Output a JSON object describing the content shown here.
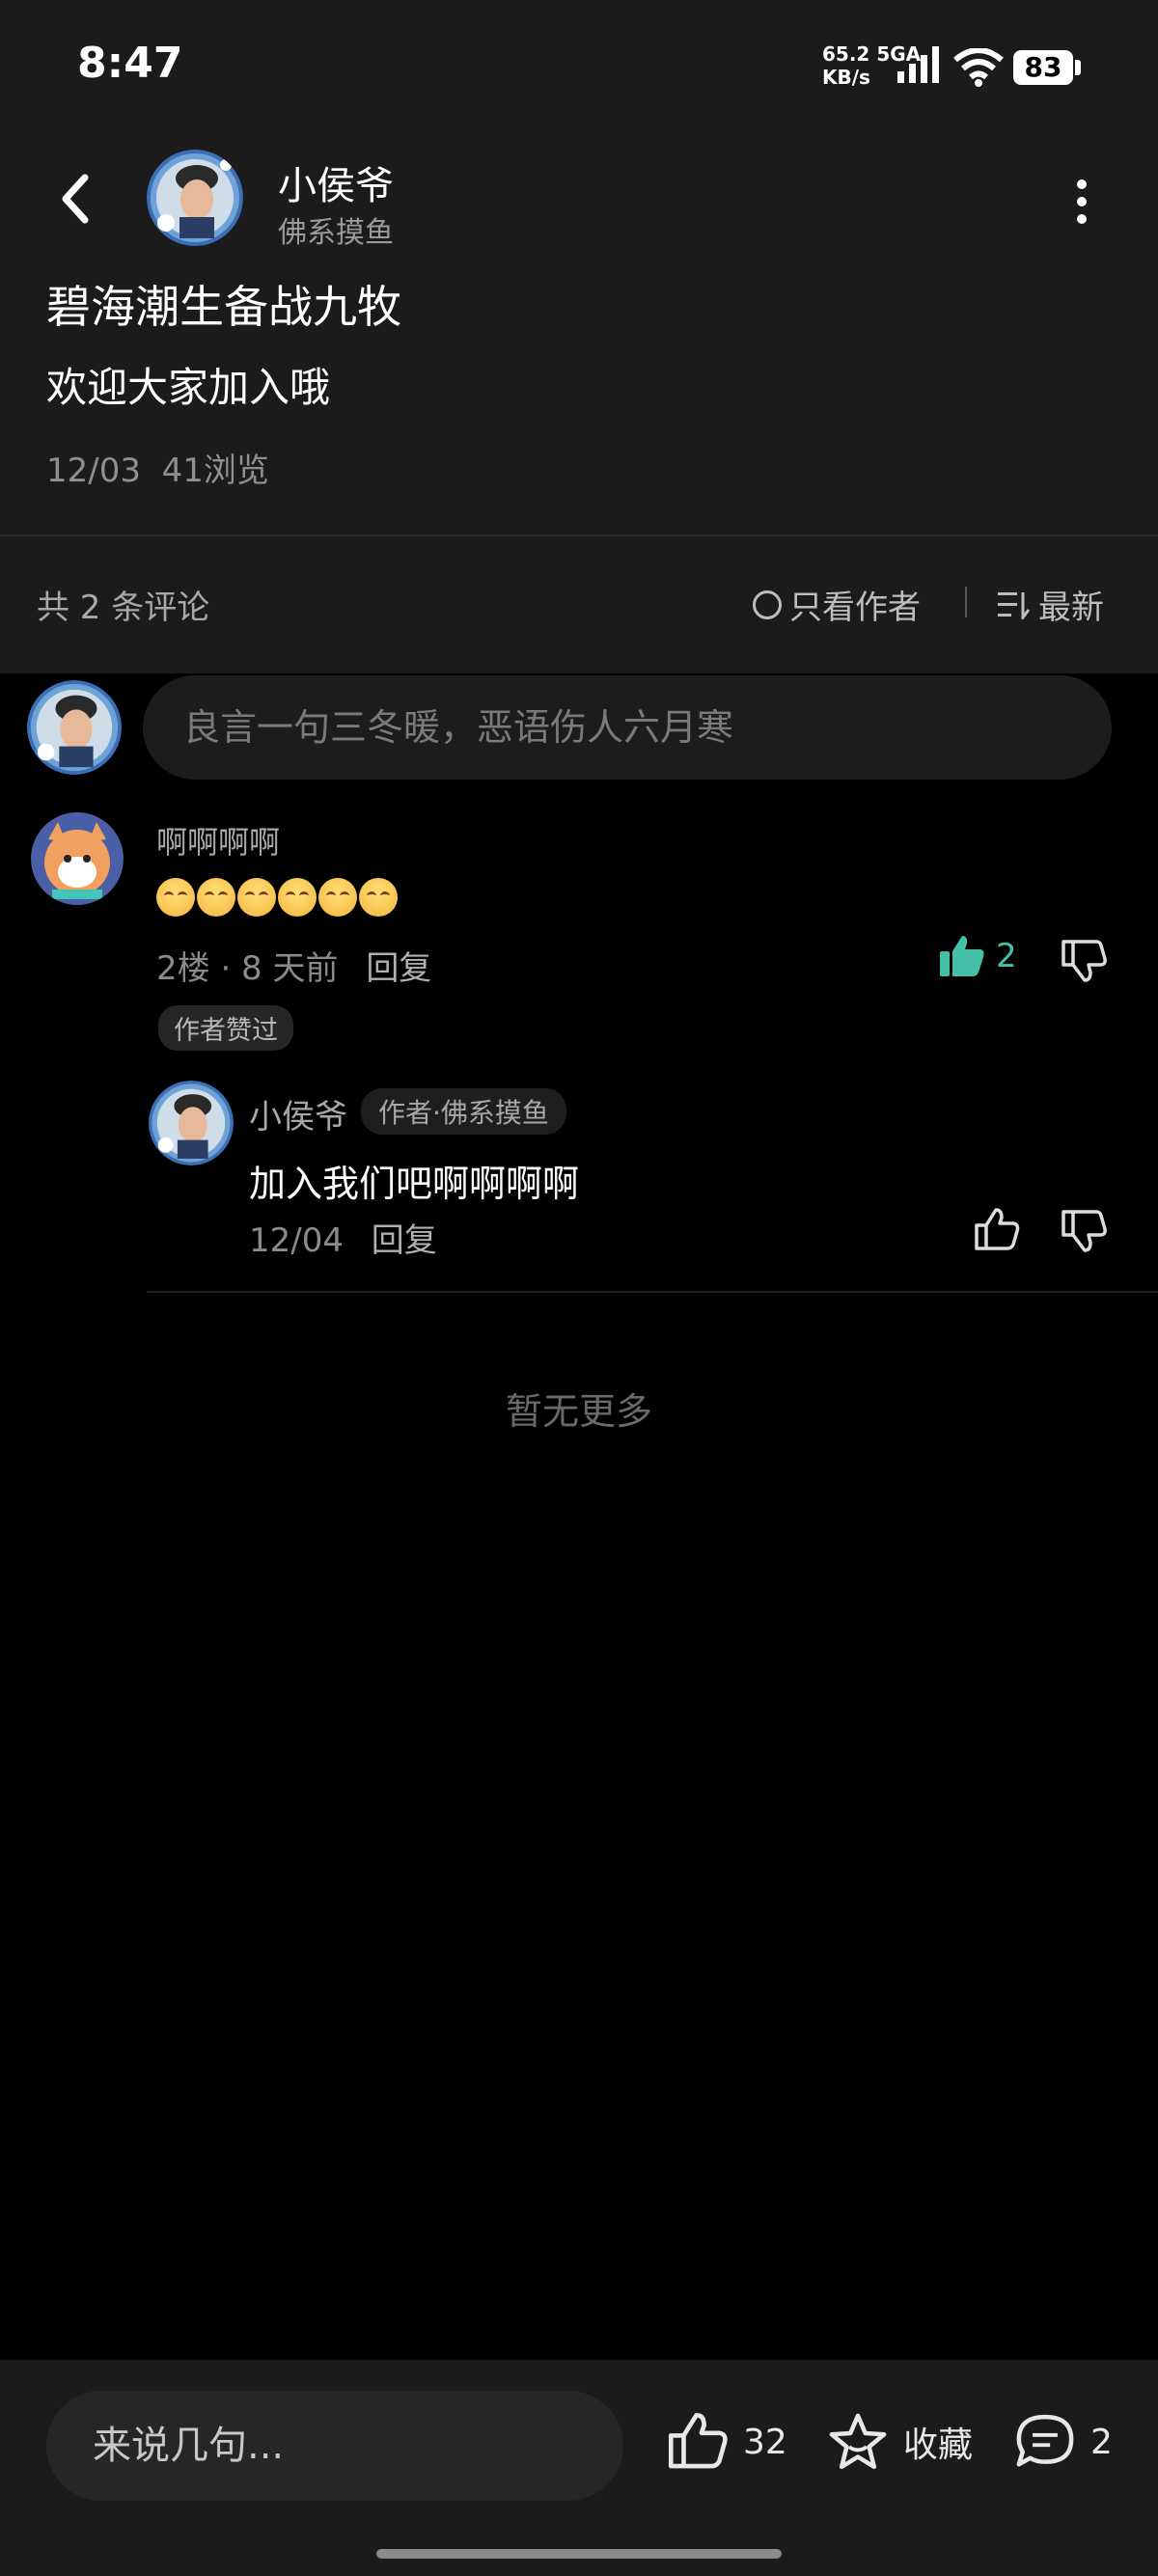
{
  "status_bar": {
    "time": "8:47",
    "net_speed_value": "65.2",
    "net_speed_unit": "KB/s",
    "network_type": "5GA",
    "battery": "83"
  },
  "header": {
    "author_name": "小侯爷",
    "author_tag": "佛系摸鱼"
  },
  "post": {
    "title": "碧海潮生备战九牧",
    "body": "欢迎大家加入哦",
    "date": "12/03",
    "views": "41浏览"
  },
  "comment_bar": {
    "count_label": "共 2 条评论",
    "only_author_label": "只看作者",
    "sort_label": "最新"
  },
  "reply_input": {
    "placeholder": "良言一句三冬暖，恶语伤人六月寒"
  },
  "comments": [
    {
      "username": "啊啊啊啊",
      "emoji_count": 6,
      "floor": "2楼 · 8 天前",
      "reply_label": "回复",
      "likes": "2",
      "badge": "作者赞过",
      "replies": [
        {
          "username": "小侯爷",
          "tag": "作者·佛系摸鱼",
          "text": "加入我们吧啊啊啊啊",
          "date": "12/04",
          "reply_label": "回复"
        }
      ]
    }
  ],
  "footer": {
    "no_more": "暂无更多",
    "input_placeholder": "来说几句...",
    "likes": "32",
    "favorite_label": "收藏",
    "comments": "2"
  },
  "colors": {
    "background": "#000000",
    "panel": "#1b1b1b",
    "accent_like": "#45c0a8"
  }
}
